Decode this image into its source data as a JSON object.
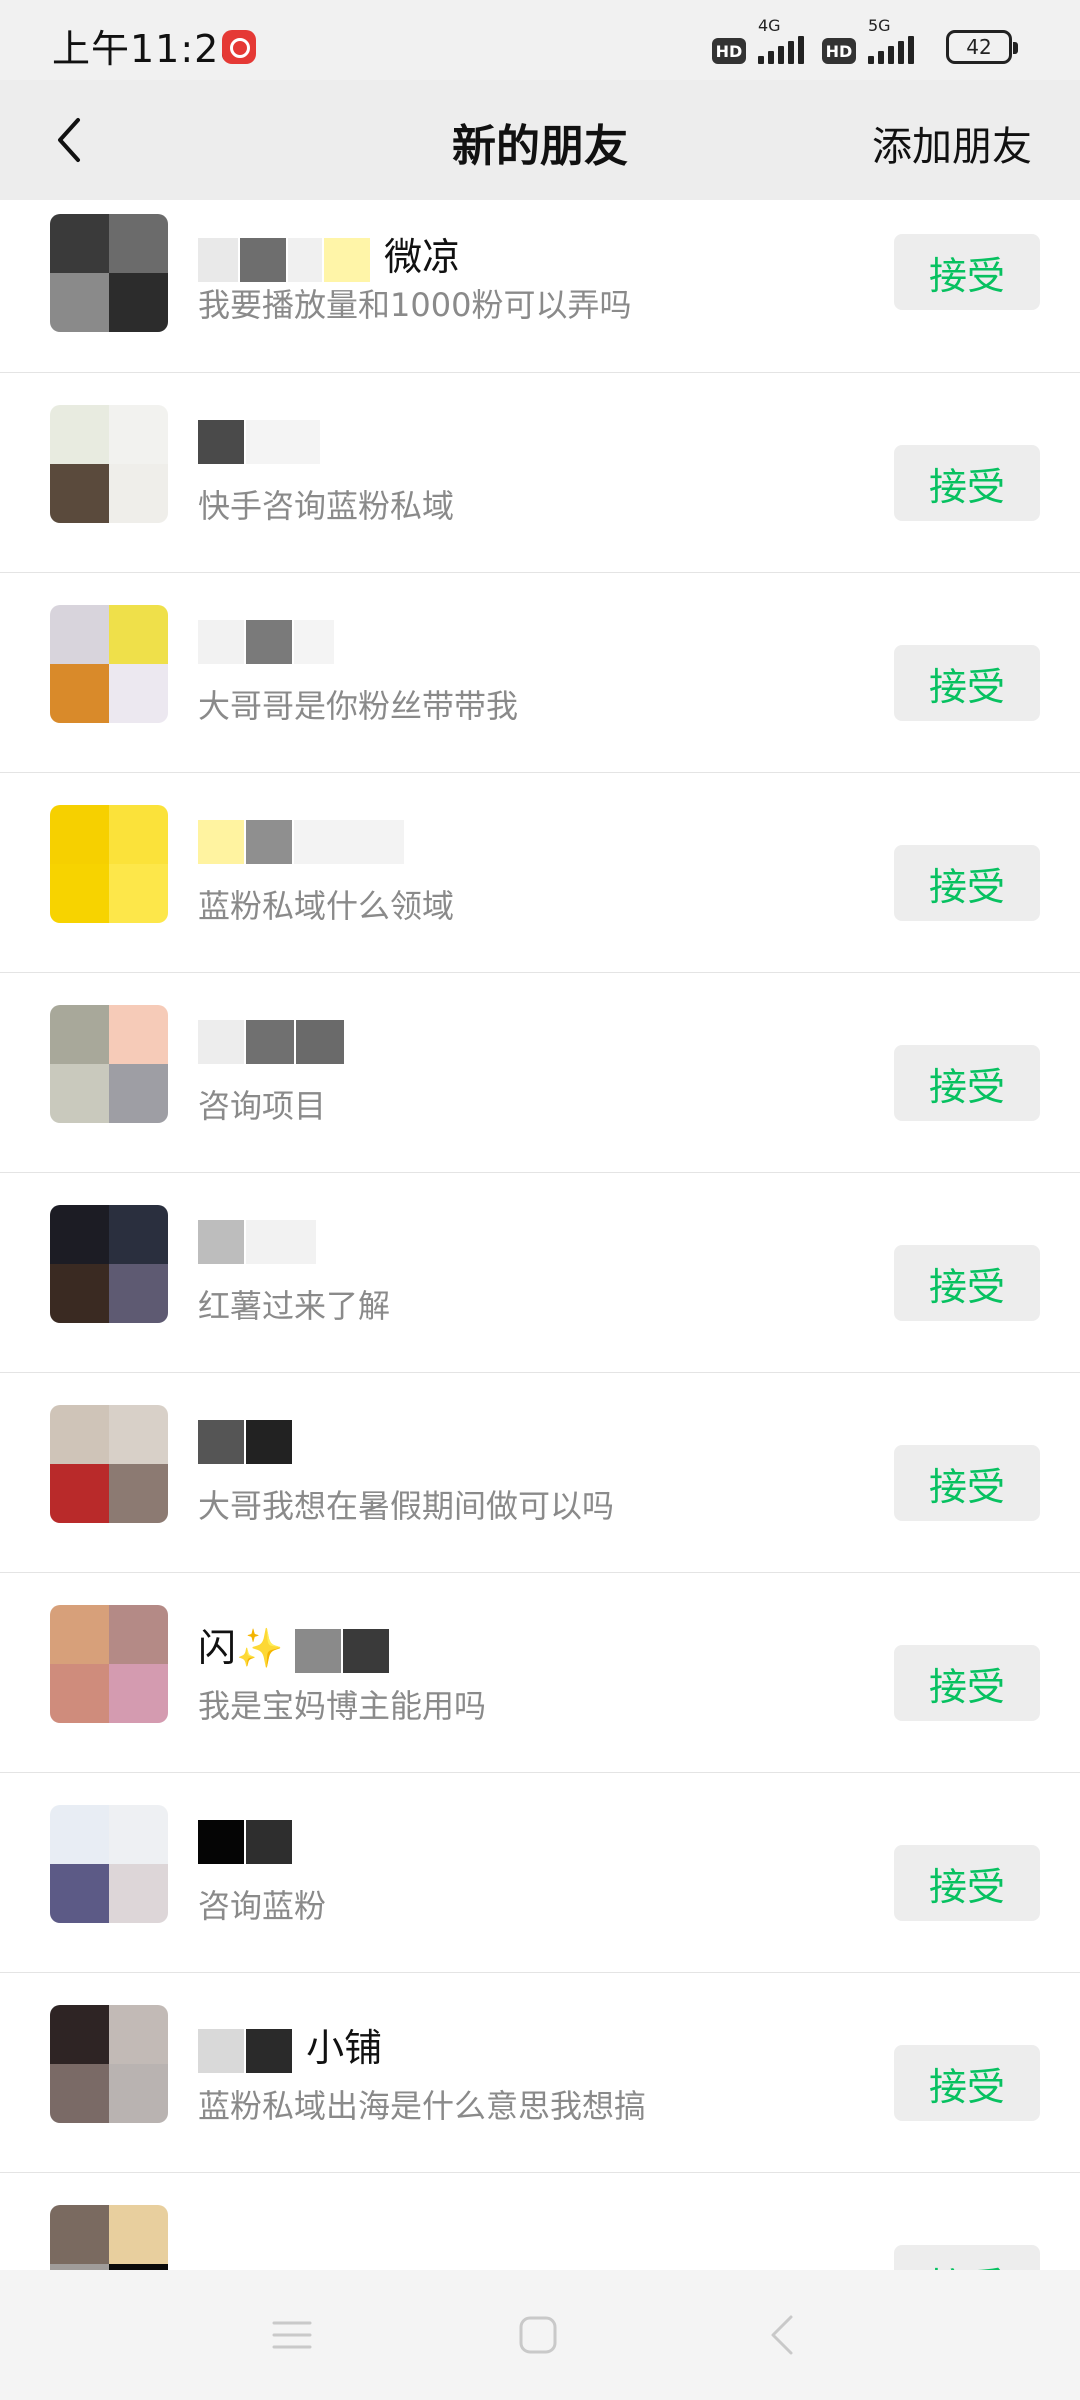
{
  "status": {
    "time": "上午11:28",
    "net1": "4G",
    "net2": "5G",
    "hd": "HD",
    "battery": "42"
  },
  "header": {
    "title": "新的朋友",
    "add_label": "添加朋友"
  },
  "requests": [
    {
      "name": "微凉",
      "message": "我要播放量和1000粉可以弄吗",
      "action": "接受"
    },
    {
      "name": "",
      "message": "快手咨询蓝粉私域",
      "action": "接受"
    },
    {
      "name": "",
      "message": "大哥哥是你粉丝带带我",
      "action": "接受"
    },
    {
      "name": "",
      "message": "蓝粉私域什么领域",
      "action": "接受"
    },
    {
      "name": "",
      "message": "咨询项目",
      "action": "接受"
    },
    {
      "name": "",
      "message": "红薯过来了解",
      "action": "接受"
    },
    {
      "name": "",
      "message": "大哥我想在暑假期间做可以吗",
      "action": "接受"
    },
    {
      "name": "闪✨",
      "message": "我是宝妈博主能用吗",
      "action": "接受"
    },
    {
      "name": "",
      "message": "咨询蓝粉",
      "action": "接受"
    },
    {
      "name": "小铺",
      "message": "蓝粉私域出海是什么意思我想搞",
      "action": "接受"
    },
    {
      "name": "",
      "message": "",
      "action": "接受"
    }
  ],
  "colors": {
    "accent": "#07c160",
    "header_bg": "#ededed"
  },
  "nav_icons": [
    "menu-icon",
    "home-icon",
    "back-icon"
  ]
}
